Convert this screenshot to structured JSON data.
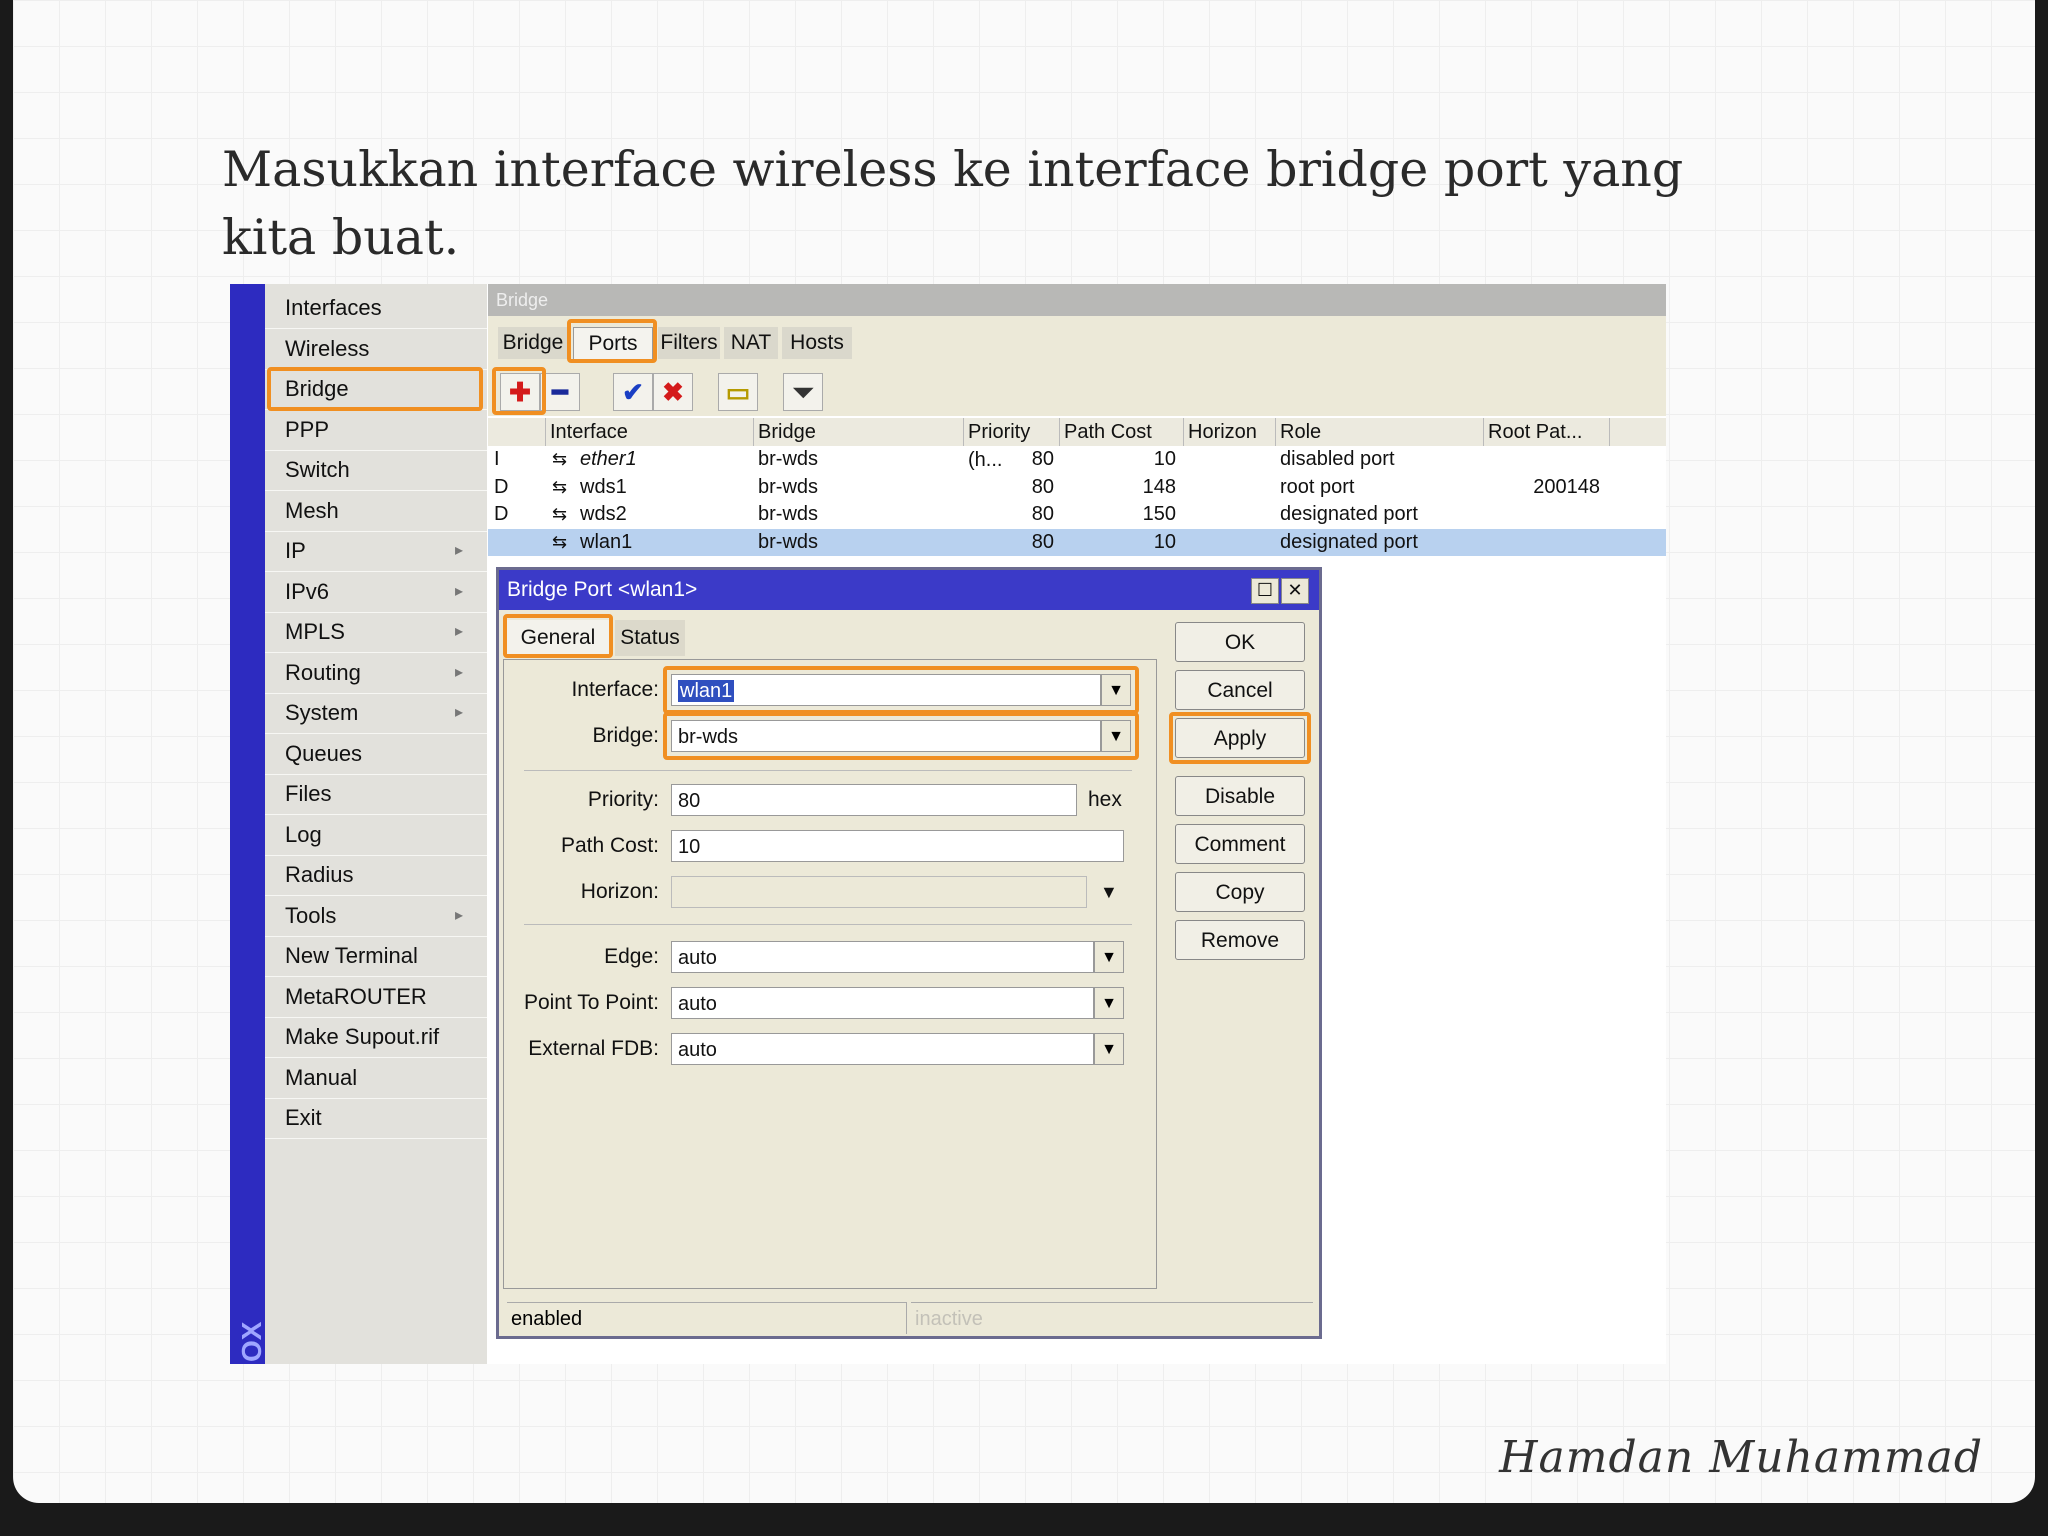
{
  "slide": {
    "title": "Masukkan interface wireless ke interface bridge port yang kita buat.",
    "footer": "Hamdan Muhammad"
  },
  "winbox": {
    "side_label": "OX",
    "menu": [
      {
        "label": "Interfaces",
        "submenu": false
      },
      {
        "label": "Wireless",
        "submenu": false
      },
      {
        "label": "Bridge",
        "submenu": false
      },
      {
        "label": "PPP",
        "submenu": false
      },
      {
        "label": "Switch",
        "submenu": false
      },
      {
        "label": "Mesh",
        "submenu": false
      },
      {
        "label": "IP",
        "submenu": true
      },
      {
        "label": "IPv6",
        "submenu": true
      },
      {
        "label": "MPLS",
        "submenu": true
      },
      {
        "label": "Routing",
        "submenu": true
      },
      {
        "label": "System",
        "submenu": true
      },
      {
        "label": "Queues",
        "submenu": false
      },
      {
        "label": "Files",
        "submenu": false
      },
      {
        "label": "Log",
        "submenu": false
      },
      {
        "label": "Radius",
        "submenu": false
      },
      {
        "label": "Tools",
        "submenu": true
      },
      {
        "label": "New Terminal",
        "submenu": false
      },
      {
        "label": "MetaROUTER",
        "submenu": false
      },
      {
        "label": "Make Supout.rif",
        "submenu": false
      },
      {
        "label": "Manual",
        "submenu": false
      },
      {
        "label": "Exit",
        "submenu": false
      }
    ],
    "selected_menu": "Bridge",
    "window_title": "Bridge",
    "tabs": [
      "Bridge",
      "Ports",
      "Filters",
      "NAT",
      "Hosts"
    ],
    "active_tab": "Ports",
    "toolbar": [
      {
        "icon": "plus-icon",
        "glyph": "✚",
        "color": "#d41a1a"
      },
      {
        "icon": "minus-icon",
        "glyph": "━",
        "color": "#1a2a9a"
      },
      {
        "icon": "check-icon",
        "glyph": "✔",
        "color": "#1a3fc4"
      },
      {
        "icon": "cross-icon",
        "glyph": "✖",
        "color": "#d41a1a"
      },
      {
        "icon": "comment-icon",
        "glyph": "▭",
        "color": "#b59a00"
      },
      {
        "icon": "filter-icon",
        "glyph": "⏷",
        "color": "#333333"
      }
    ],
    "table": {
      "headers": [
        "Interface",
        "Bridge",
        "Priority (h...",
        "Path Cost",
        "Horizon",
        "Role",
        "Root Pat..."
      ],
      "rows": [
        {
          "flag": "I",
          "interface": "ether1",
          "bridge": "br-wds",
          "priority": "80",
          "path_cost": "10",
          "horizon": "",
          "role": "disabled port",
          "root_path": "",
          "italic": true,
          "selected": false
        },
        {
          "flag": "D",
          "interface": "wds1",
          "bridge": "br-wds",
          "priority": "80",
          "path_cost": "148",
          "horizon": "",
          "role": "root port",
          "root_path": "200148",
          "italic": false,
          "selected": false
        },
        {
          "flag": "D",
          "interface": "wds2",
          "bridge": "br-wds",
          "priority": "80",
          "path_cost": "150",
          "horizon": "",
          "role": "designated port",
          "root_path": "",
          "italic": false,
          "selected": false
        },
        {
          "flag": "",
          "interface": "wlan1",
          "bridge": "br-wds",
          "priority": "80",
          "path_cost": "10",
          "horizon": "",
          "role": "designated port",
          "root_path": "",
          "italic": false,
          "selected": true
        }
      ]
    },
    "dialog": {
      "title": "Bridge Port <wlan1>",
      "tabs": [
        "General",
        "Status"
      ],
      "active_tab": "General",
      "fields": {
        "interface": {
          "label": "Interface:",
          "value": "wlan1"
        },
        "bridge": {
          "label": "Bridge:",
          "value": "br-wds"
        },
        "priority": {
          "label": "Priority:",
          "value": "80",
          "unit": "hex"
        },
        "path_cost": {
          "label": "Path Cost:",
          "value": "10"
        },
        "horizon": {
          "label": "Horizon:",
          "value": ""
        },
        "edge": {
          "label": "Edge:",
          "value": "auto"
        },
        "point_to_point": {
          "label": "Point To Point:",
          "value": "auto"
        },
        "external_fdb": {
          "label": "External FDB:",
          "value": "auto"
        }
      },
      "buttons": [
        "OK",
        "Cancel",
        "Apply",
        "Disable",
        "Comment",
        "Copy",
        "Remove"
      ],
      "status_left": "enabled",
      "status_right": "inactive"
    },
    "highlight_color": "#f08f22"
  }
}
